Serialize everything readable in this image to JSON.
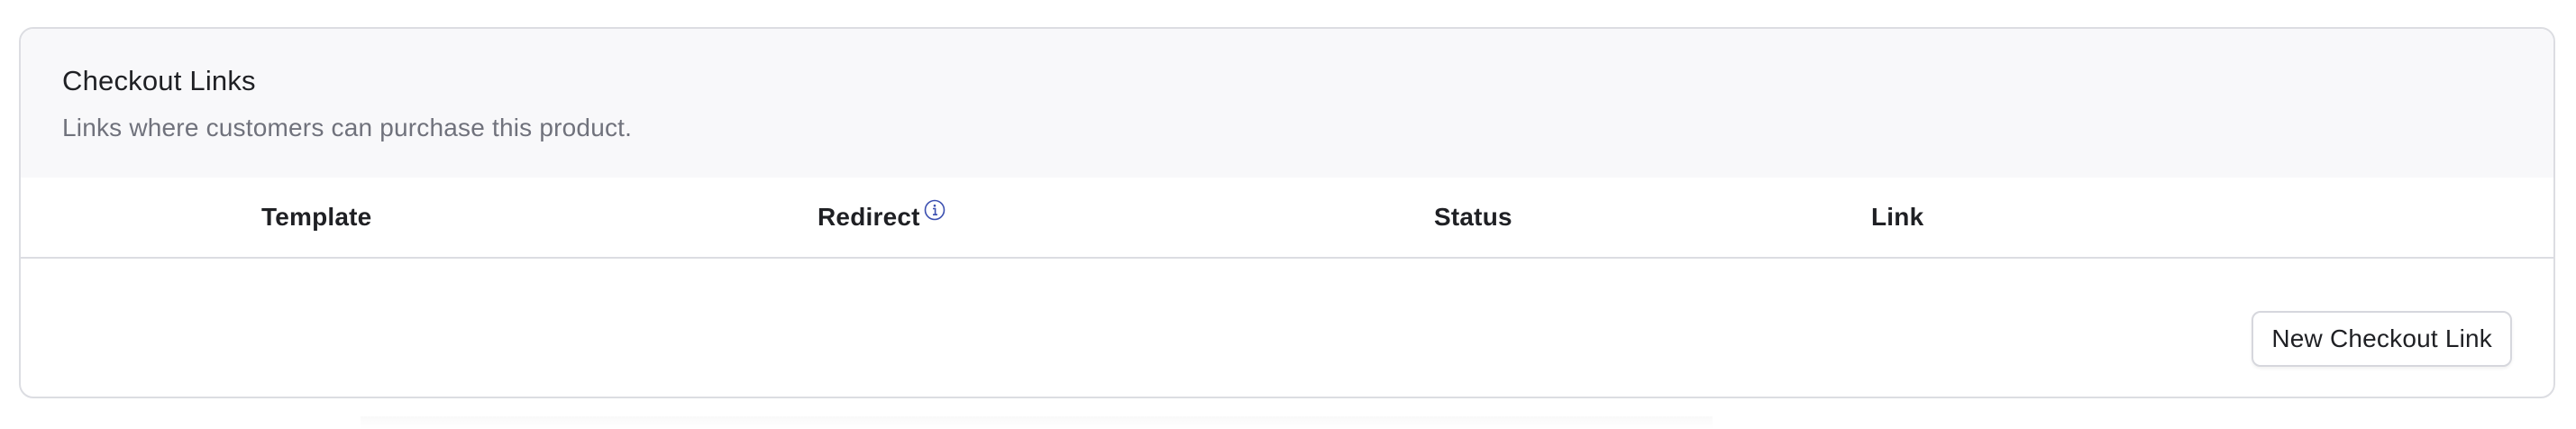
{
  "card": {
    "title": "Checkout Links",
    "subtitle": "Links where customers can purchase this product."
  },
  "table": {
    "columns": [
      "Template",
      "Redirect",
      "Status",
      "Link"
    ],
    "redirect_icon": "info-icon",
    "rows": []
  },
  "actions": {
    "new_link_label": "New Checkout Link"
  },
  "colors": {
    "info_icon": "#3b4fb0",
    "border": "#dcdde2",
    "header_bg": "#f8f8fa"
  }
}
